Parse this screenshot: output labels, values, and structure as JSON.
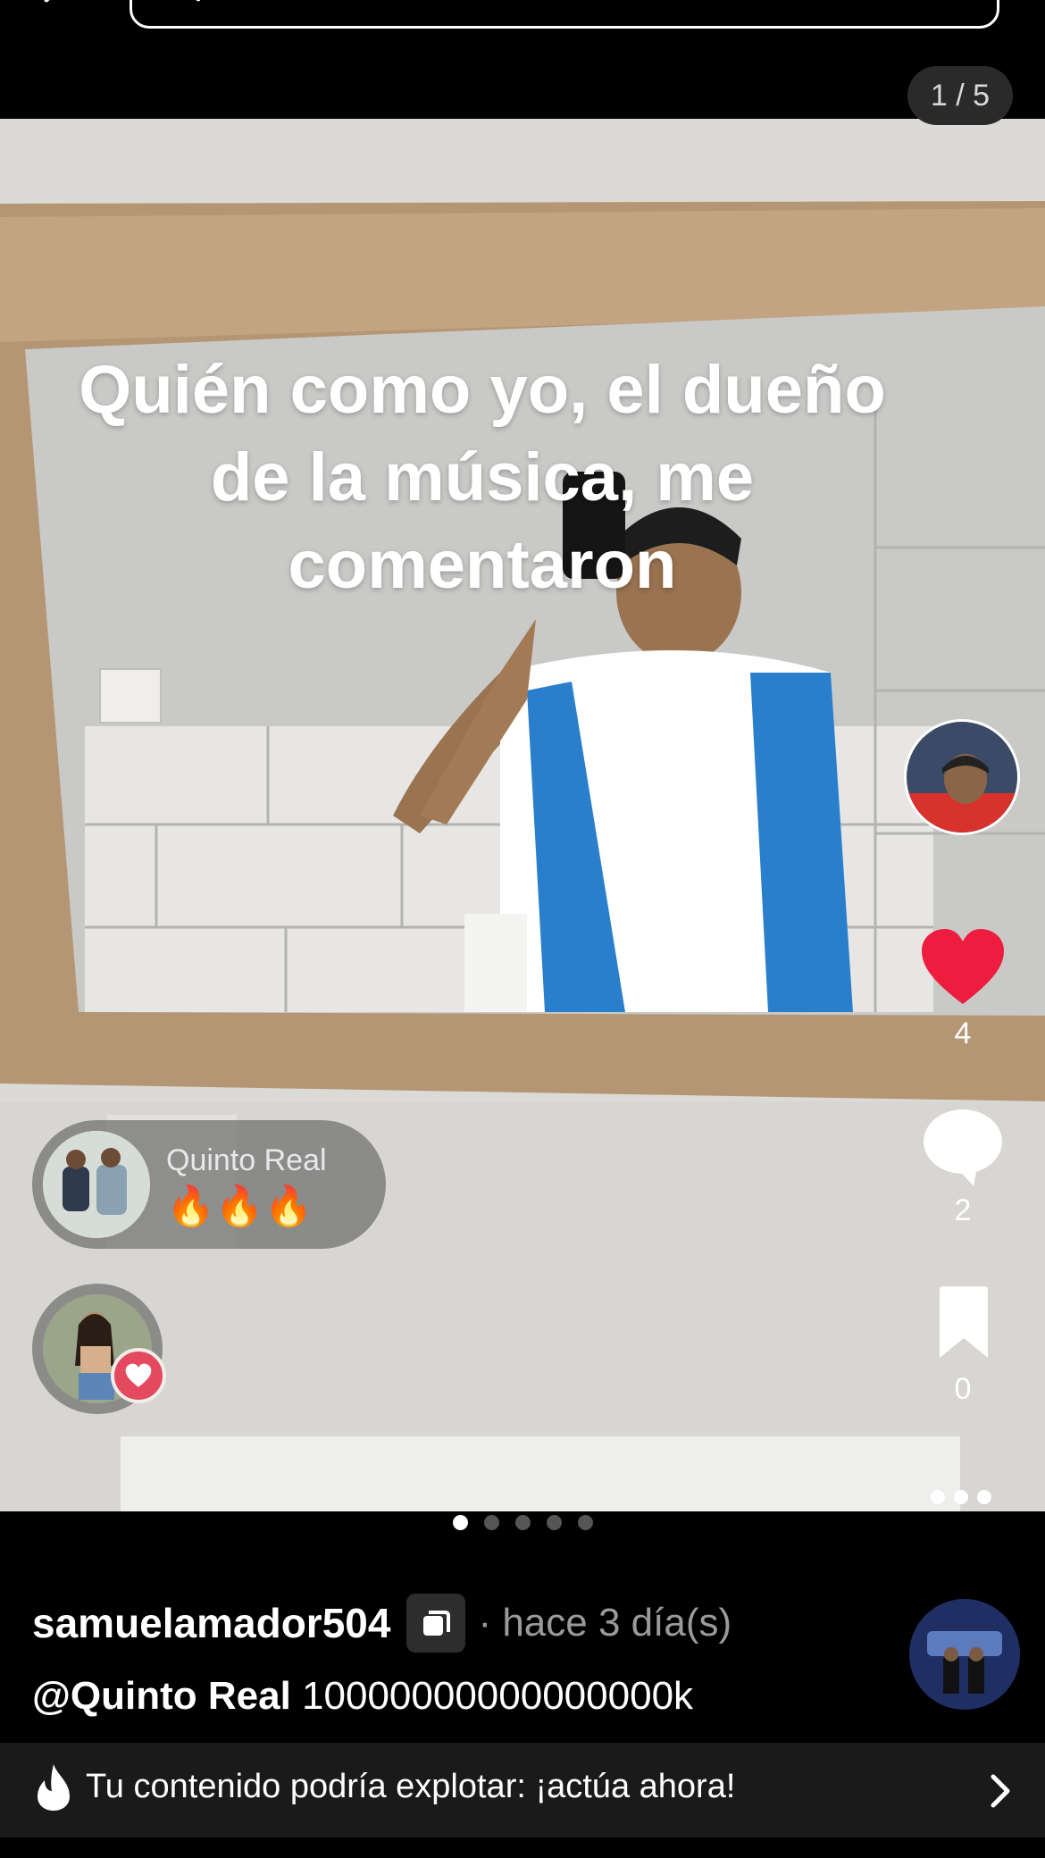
{
  "search": {
    "placeholder": ""
  },
  "media": {
    "page_indicator": "1 / 5",
    "caption_overlay": [
      "Quién como yo, el dueño",
      "de la música, me",
      "comentaron"
    ],
    "total_slides": 5,
    "active_slide": 1
  },
  "actions": {
    "likes": "4",
    "comments": "2",
    "bookmarks": "0",
    "like_color": "#ee1d3f"
  },
  "music": {
    "title": "Quinto Real",
    "emojis": "🔥🔥🔥"
  },
  "post": {
    "username": "samuelamador504",
    "timestamp": "· hace 3 día(s)",
    "mention": "@Quinto Real",
    "text": " 10000000000000000k"
  },
  "promo": {
    "text": "Tu contenido podría explotar: ¡actúa ahora!"
  }
}
